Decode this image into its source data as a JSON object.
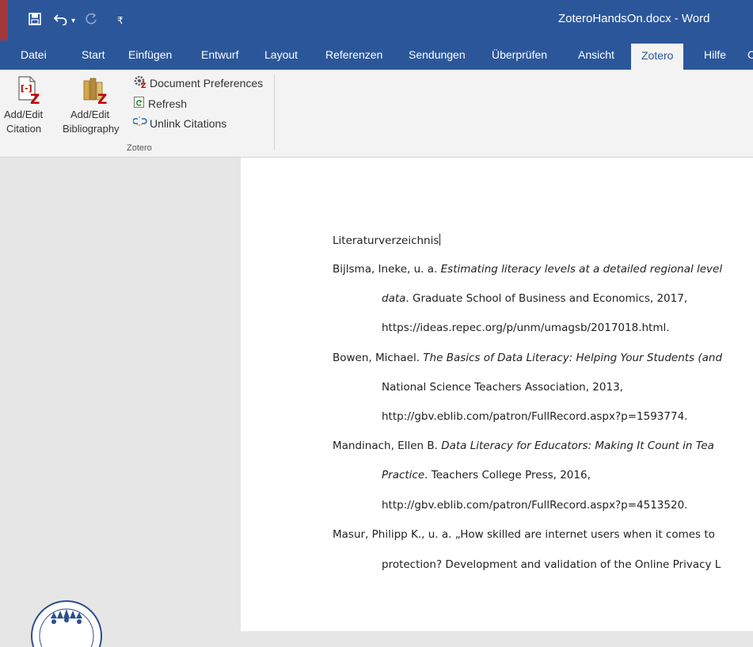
{
  "window": {
    "title": "ZoteroHandsOn.docx - Word"
  },
  "quick_access": {
    "icons": [
      "save-icon",
      "undo-icon",
      "redo-icon",
      "customize-qat-icon"
    ]
  },
  "tabs": [
    {
      "label": "Datei"
    },
    {
      "label": "Start"
    },
    {
      "label": "Einfügen"
    },
    {
      "label": "Entwurf"
    },
    {
      "label": "Layout"
    },
    {
      "label": "Referenzen"
    },
    {
      "label": "Sendungen"
    },
    {
      "label": "Überprüfen"
    },
    {
      "label": "Ansicht"
    },
    {
      "label": "Zotero",
      "active": true
    },
    {
      "label": "Hilfe"
    },
    {
      "label": "C"
    }
  ],
  "ribbon": {
    "add_edit_citation": "Add/Edit\nCitation",
    "add_edit_citation_l1": "Add/Edit",
    "add_edit_citation_l2": "Citation",
    "add_edit_bibliography_l1": "Add/Edit",
    "add_edit_bibliography_l2": "Bibliography",
    "document_preferences": "Document Preferences",
    "refresh": "Refresh",
    "unlink_citations": "Unlink Citations",
    "group_label": "Zotero"
  },
  "document": {
    "heading": "Literaturverzeichnis",
    "entries": [
      {
        "l1_plain": "Bijlsma, Ineke, u. a. ",
        "l1_italic": "Estimating literacy levels at a detailed regional level",
        "l2_italic": "data",
        "l2_plain": ". Graduate School of Business and Economics, 2017,",
        "l3": "https://ideas.repec.org/p/unm/umagsb/2017018.html."
      },
      {
        "l1_plain": "Bowen, Michael. ",
        "l1_italic": "The Basics of Data Literacy: Helping Your Students (and",
        "l2_plain": "National Science Teachers Association, 2013,",
        "l3": "http://gbv.eblib.com/patron/FullRecord.aspx?p=1593774."
      },
      {
        "l1_plain": "Mandinach, Ellen B. ",
        "l1_italic": "Data Literacy for Educators: Making It Count in Tea",
        "l2_italic": "Practice",
        "l2_plain": ". Teachers College Press, 2016,",
        "l3": "http://gbv.eblib.com/patron/FullRecord.aspx?p=4513520."
      },
      {
        "l1": "Masur, Philipp K., u. a. „How skilled are internet users when it comes to",
        "l2": "protection? Development and validation of the Online Privacy L"
      }
    ]
  },
  "colors": {
    "word_blue": "#2b579a",
    "ribbon_bg": "#f3f3f3",
    "zotero_red": "#c00000"
  }
}
